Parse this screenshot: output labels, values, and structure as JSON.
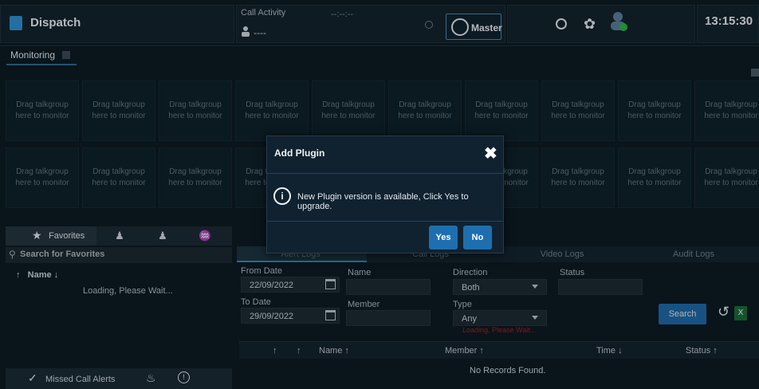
{
  "header": {
    "app_title": "Dispatch",
    "call_activity_label": "Call Activity",
    "call_timer": "--:--:--",
    "call_user": "----",
    "master_label": "Master",
    "clock": "13:15:30"
  },
  "monitoring": {
    "tab_label": "Monitoring",
    "tile_text_line1": "Drag talkgroup",
    "tile_text_line2": "here to monitor"
  },
  "favorites": {
    "tab_label": "Favorites",
    "search_placeholder": "Search for Favorites",
    "name_column": "Name ↓",
    "loading": "Loading, Please Wait..."
  },
  "bottom_bar": {
    "missed_calls_label": "Missed Call Alerts"
  },
  "logs": {
    "tabs": [
      "Alert Logs",
      "Call Logs",
      "Video Logs",
      "Audit Logs"
    ],
    "from_date_label": "From Date",
    "from_date": "22/09/2022",
    "to_date_label": "To Date",
    "to_date": "29/09/2022",
    "name_label": "Name",
    "member_label": "Member",
    "direction_label": "Direction",
    "direction_value": "Both",
    "type_label": "Type",
    "type_value": "Any",
    "type_loading": "Loading, Please Wait...",
    "status_label": "Status",
    "search_button": "Search",
    "table_headers": {
      "sort_a": "↑",
      "sort_b": "↑",
      "name": "Name ↑",
      "member": "Member ↑",
      "time": "Time ↓",
      "status": "Status ↑"
    },
    "no_records": "No Records Found."
  },
  "modal": {
    "title": "Add Plugin",
    "close": "✖",
    "message": "New Plugin version is available, Click Yes to upgrade.",
    "yes": "Yes",
    "no": "No"
  },
  "colors": {
    "accent": "#1e6fb0",
    "background": "#0c1a23",
    "status_online": "#2db34a"
  }
}
